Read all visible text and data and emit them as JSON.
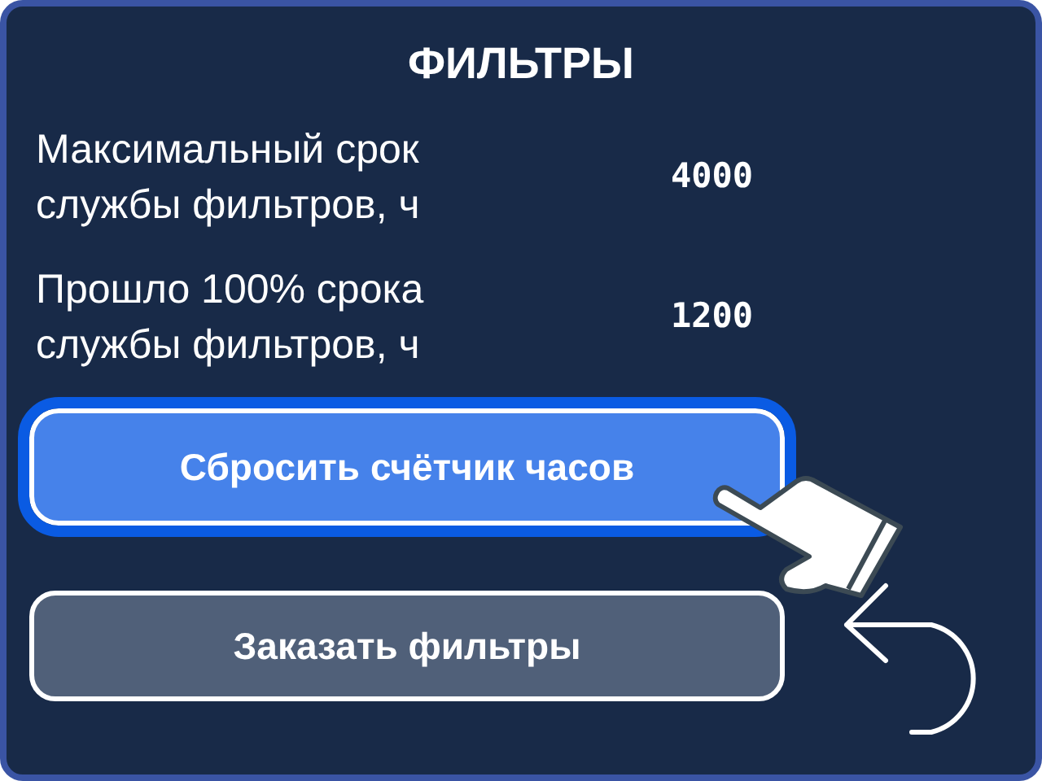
{
  "title": "ФИЛЬТРЫ",
  "rows": [
    {
      "label": "Максимальный срок службы фильтров, ч",
      "value": "4000"
    },
    {
      "label": "Прошло 100% срока службы фильтров, ч",
      "value": "1200"
    }
  ],
  "buttons": [
    {
      "label": "Сбросить счётчик часов",
      "selected": true
    },
    {
      "label": "Заказать фильтры",
      "selected": false
    }
  ]
}
